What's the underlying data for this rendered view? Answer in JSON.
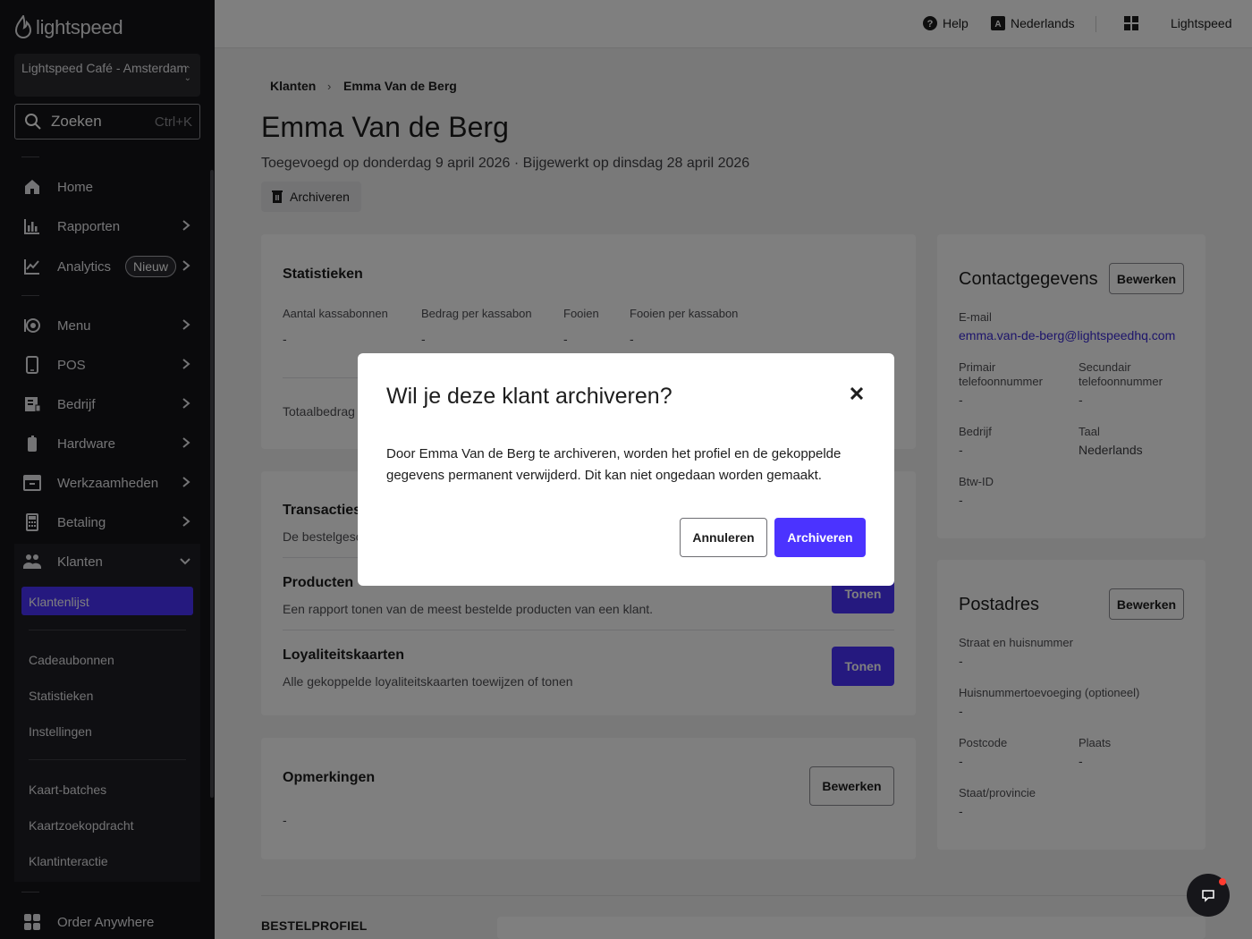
{
  "sidebar": {
    "logo_text": "lightspeed",
    "store_name": "Lightspeed Café - Amsterdam",
    "search": {
      "placeholder": "Zoeken",
      "shortcut": "Ctrl+K"
    },
    "nav": [
      {
        "label": "Home",
        "icon": "home-icon"
      },
      {
        "label": "Rapporten",
        "icon": "bar-chart-icon"
      },
      {
        "label": "Analytics",
        "icon": "line-chart-icon",
        "badge": "Nieuw"
      },
      {
        "label": "Menu",
        "icon": "menu-book-icon"
      },
      {
        "label": "POS",
        "icon": "tablet-icon"
      },
      {
        "label": "Bedrijf",
        "icon": "building-icon"
      },
      {
        "label": "Hardware",
        "icon": "device-icon"
      },
      {
        "label": "Werkzaamheden",
        "icon": "inbox-icon"
      },
      {
        "label": "Betaling",
        "icon": "calculator-icon"
      },
      {
        "label": "Klanten",
        "icon": "users-icon"
      }
    ],
    "sub_items": [
      "Klantenlijst",
      "Cadeaubonnen",
      "Statistieken",
      "Instellingen",
      "Kaart-batches",
      "Kaartzoekopdracht",
      "Klantinteractie"
    ],
    "bottom_item": {
      "label": "Order Anywhere",
      "icon": "grid-icon"
    }
  },
  "topbar": {
    "help": "Help",
    "language": "Nederlands",
    "account": "Lightspeed"
  },
  "breadcrumb": {
    "parent": "Klanten",
    "current": "Emma Van de Berg"
  },
  "page": {
    "title": "Emma Van de Berg",
    "subtitle": "Toegevoegd op donderdag 9 april 2026 · Bijgewerkt op dinsdag 28 april 2026",
    "archive_label": "Archiveren"
  },
  "stats": {
    "title": "Statistieken",
    "columns": [
      {
        "label": "Aantal kassabonnen",
        "value": "-"
      },
      {
        "label": "Bedrag per kassabon",
        "value": "-"
      },
      {
        "label": "Fooien",
        "value": "-"
      },
      {
        "label": "Fooien per kassabon",
        "value": "-"
      }
    ],
    "total_label": "Totaalbedrag"
  },
  "reports": {
    "transacties": {
      "title": "Transacties",
      "desc": "De bestelgesc"
    },
    "producten": {
      "title": "Producten",
      "desc": "Een rapport tonen van de meest bestelde producten van een klant.",
      "button": "Tonen"
    },
    "loyaliteit": {
      "title": "Loyaliteitskaarten",
      "desc": "Alle gekoppelde loyaliteitskaarten toewijzen of tonen",
      "button": "Tonen"
    }
  },
  "notes": {
    "title": "Opmerkingen",
    "value": "-",
    "button": "Bewerken"
  },
  "contact": {
    "title": "Contactgegevens",
    "button": "Bewerken",
    "email_label": "E-mail",
    "email": "emma.van-de-berg@lightspeedhq.com",
    "phone1_label": "Primair telefoonnummer",
    "phone1": "-",
    "phone2_label": "Secundair telefoonnummer",
    "phone2": "-",
    "company_label": "Bedrijf",
    "company": "-",
    "language_label": "Taal",
    "language": "Nederlands",
    "vat_label": "Btw-ID",
    "vat": "-"
  },
  "address": {
    "title": "Postadres",
    "button": "Bewerken",
    "street_label": "Straat en huisnummer",
    "street": "-",
    "suffix_label": "Huisnummertoevoeging (optioneel)",
    "suffix": "-",
    "postcode_label": "Postcode",
    "postcode": "-",
    "city_label": "Plaats",
    "city": "-",
    "state_label": "Staat/provincie",
    "state": "-"
  },
  "section_heading": "BESTELPROFIEL",
  "modal": {
    "title": "Wil je deze klant archiveren?",
    "body": "Door Emma Van de Berg te archiveren, worden het profiel en de gekoppelde gegevens permanent verwijderd. Dit kan niet ongedaan worden gemaakt.",
    "cancel": "Annuleren",
    "confirm": "Archiveren"
  },
  "colors": {
    "accent": "#4b33ff",
    "sidebar": "#151518",
    "overlay": "rgba(0,0,0,0.5)"
  }
}
